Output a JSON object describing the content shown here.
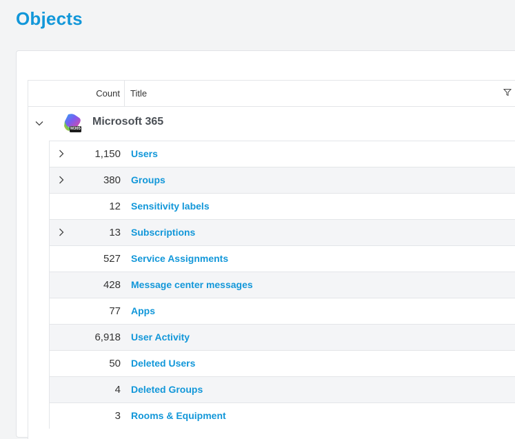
{
  "page": {
    "title": "Objects"
  },
  "table": {
    "columns": {
      "count": "Count",
      "title": "Title"
    },
    "group": {
      "label": "Microsoft 365",
      "logo_text": "M365",
      "expanded": true
    },
    "rows": [
      {
        "count": "1,150",
        "title": "Users",
        "expandable": true
      },
      {
        "count": "380",
        "title": "Groups",
        "expandable": true
      },
      {
        "count": "12",
        "title": "Sensitivity labels",
        "expandable": false
      },
      {
        "count": "13",
        "title": "Subscriptions",
        "expandable": true
      },
      {
        "count": "527",
        "title": "Service Assignments",
        "expandable": false
      },
      {
        "count": "428",
        "title": "Message center messages",
        "expandable": false
      },
      {
        "count": "77",
        "title": "Apps",
        "expandable": false
      },
      {
        "count": "6,918",
        "title": "User Activity",
        "expandable": false
      },
      {
        "count": "50",
        "title": "Deleted Users",
        "expandable": false
      },
      {
        "count": "4",
        "title": "Deleted Groups",
        "expandable": false
      },
      {
        "count": "3",
        "title": "Rooms & Equipment",
        "expandable": false
      }
    ]
  },
  "icons": {
    "expand": "chevron-right-icon",
    "collapse": "chevron-down-icon",
    "filter": "filter-icon",
    "logo": "microsoft-365-logo"
  },
  "colors": {
    "accent": "#1297d9",
    "text": "#333333",
    "group_label": "#4a4f55",
    "row_alt": "#f4f5f7"
  }
}
